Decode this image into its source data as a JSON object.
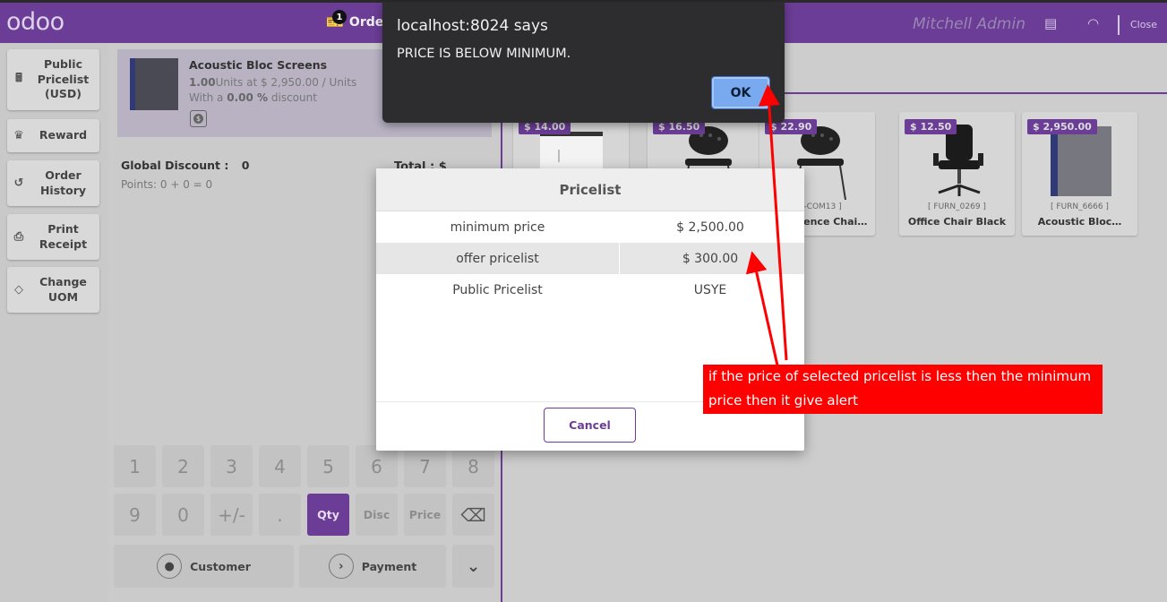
{
  "header": {
    "logo": "odoo",
    "orders_label": "Order",
    "orders_count": "1",
    "user": "Mitchell Admin",
    "close_label": "Close"
  },
  "controls": [
    {
      "icon": "calculator-icon",
      "glyph": "🖩",
      "label": "Public Pricelist (USD)"
    },
    {
      "icon": "award-icon",
      "glyph": "♛",
      "label": "Reward"
    },
    {
      "icon": "history-icon",
      "glyph": "↺",
      "label": "Order History"
    },
    {
      "icon": "print-icon",
      "glyph": "⎙",
      "label": "Print Receipt"
    },
    {
      "icon": "tag-icon",
      "glyph": "◇",
      "label": "Change UOM"
    }
  ],
  "order": {
    "line": {
      "name": "Acoustic Bloc Screens",
      "qty": "1.00",
      "qty_rest": "Units at $ 2,950.00 / Units",
      "disc_prefix": "With a ",
      "disc_value": "0.00 %",
      "disc_suffix": " discount"
    },
    "global_discount_label": "Global Discount :",
    "global_discount_value": "0",
    "points": "Points: 0 + 0 = 0",
    "total": "Total : $ 2,950.00"
  },
  "numpad": {
    "row1": [
      "1",
      "2",
      "3",
      "4",
      "5",
      "6",
      "7",
      "8"
    ],
    "row2": [
      "9",
      "0",
      "+/-",
      ".",
      "Qty",
      "Disc",
      "Price",
      "⌫"
    ],
    "active": "Qty"
  },
  "actions": {
    "customer": "Customer",
    "payment": "Payment",
    "more": "⌄"
  },
  "products": [
    {
      "price": "$ 14.00",
      "ref": "",
      "name": ""
    },
    {
      "price": "$ 16.50",
      "ref": "",
      "name": ""
    },
    {
      "price": "$ 22.90",
      "ref": "[ E-COM13 ]",
      "name": "Conference Chair…"
    },
    {
      "price": "$ 12.50",
      "ref": "[ FURN_0269 ]",
      "name": "Office Chair Black"
    },
    {
      "price": "$ 2,950.00",
      "ref": "[ FURN_6666 ]",
      "name": "Acoustic Bloc…"
    }
  ],
  "alert": {
    "title": "localhost:8024 says",
    "message": "PRICE IS BELOW MINIMUM.",
    "ok": "OK"
  },
  "pricelist_popup": {
    "title": "Pricelist",
    "rows": [
      {
        "name": "minimum price",
        "value": "$ 2,500.00"
      },
      {
        "name": "offer pricelist",
        "value": "$ 300.00"
      },
      {
        "name": "Public Pricelist",
        "value": "USYE"
      }
    ],
    "cancel": "Cancel"
  },
  "annotation": {
    "text": "if the price of selected pricelist is less then the minimum price then it give alert",
    "color": "#ff0000"
  },
  "colors": {
    "brand": "#6b3d96",
    "alert_bg": "#2d2d30",
    "ok_button": "#79aaf0"
  }
}
